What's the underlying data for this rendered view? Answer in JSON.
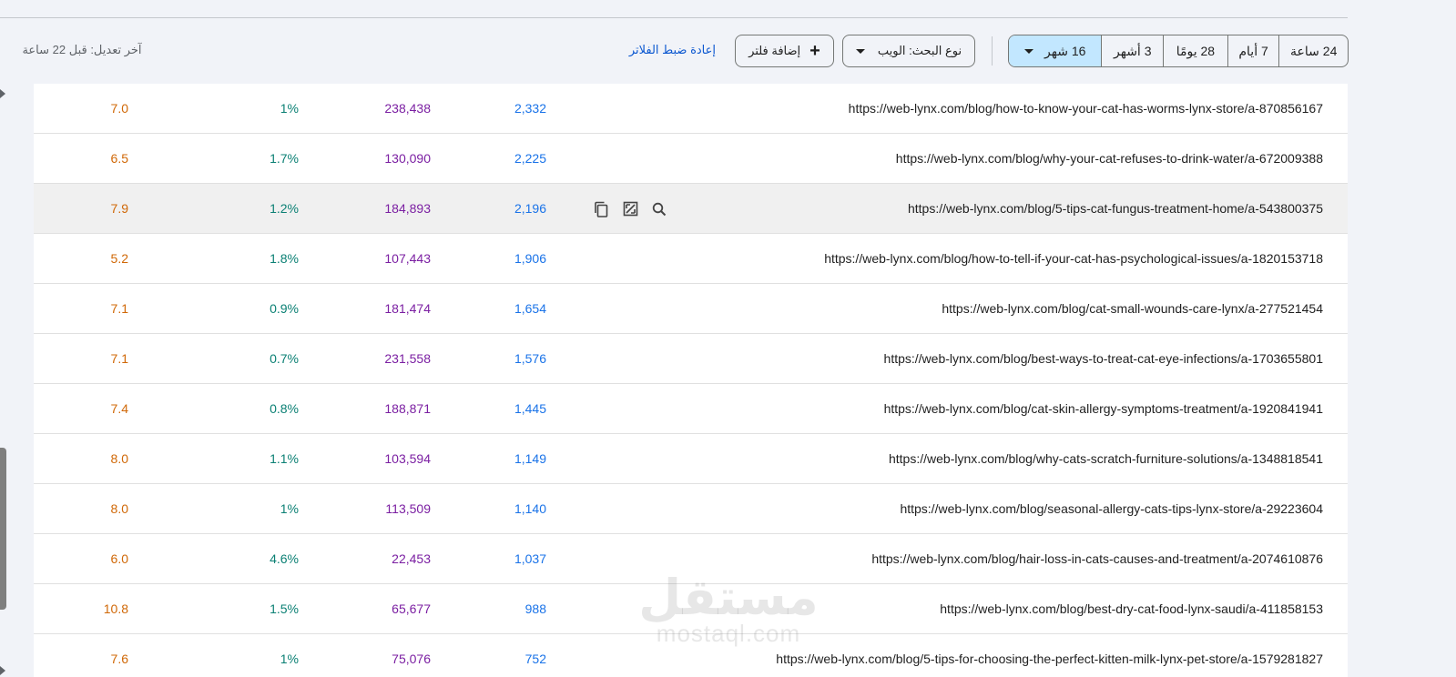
{
  "toolbar": {
    "date_ranges": [
      {
        "label": "24 ساعة",
        "active": false
      },
      {
        "label": "7 أيام",
        "active": false
      },
      {
        "label": "28 يومًا",
        "active": false
      },
      {
        "label": "3 أشهر",
        "active": false
      },
      {
        "label": "16 شهر",
        "active": true
      }
    ],
    "search_type_label": "نوع البحث: الويب",
    "add_filter_label": "إضافة فلتر",
    "reset_filters_label": "إعادة ضبط الفلاتر",
    "last_updated": "آخر تعديل: قبل 22 ساعة"
  },
  "colors": {
    "clicks": "#1a73e8",
    "impressions": "#7b1fa2",
    "ctr": "#0b8074",
    "position": "#d06807",
    "active_segment": "#c2e7ff"
  },
  "row_actions": [
    "copy-icon",
    "open-in-new-icon",
    "search-icon"
  ],
  "rows": [
    {
      "url": "https://web-lynx.com/blog/how-to-know-your-cat-has-worms-lynx-store/a-870856167",
      "clicks": "2,332",
      "impressions": "238,438",
      "ctr": "1%",
      "position": "7.0"
    },
    {
      "url": "https://web-lynx.com/blog/why-your-cat-refuses-to-drink-water/a-672009388",
      "clicks": "2,225",
      "impressions": "130,090",
      "ctr": "1.7%",
      "position": "6.5"
    },
    {
      "url": "https://web-lynx.com/blog/5-tips-cat-fungus-treatment-home/a-543800375",
      "clicks": "2,196",
      "impressions": "184,893",
      "ctr": "1.2%",
      "position": "7.9",
      "hover": true
    },
    {
      "url": "https://web-lynx.com/blog/how-to-tell-if-your-cat-has-psychological-issues/a-1820153718",
      "clicks": "1,906",
      "impressions": "107,443",
      "ctr": "1.8%",
      "position": "5.2"
    },
    {
      "url": "https://web-lynx.com/blog/cat-small-wounds-care-lynx/a-277521454",
      "clicks": "1,654",
      "impressions": "181,474",
      "ctr": "0.9%",
      "position": "7.1"
    },
    {
      "url": "https://web-lynx.com/blog/best-ways-to-treat-cat-eye-infections/a-1703655801",
      "clicks": "1,576",
      "impressions": "231,558",
      "ctr": "0.7%",
      "position": "7.1"
    },
    {
      "url": "https://web-lynx.com/blog/cat-skin-allergy-symptoms-treatment/a-1920841941",
      "clicks": "1,445",
      "impressions": "188,871",
      "ctr": "0.8%",
      "position": "7.4"
    },
    {
      "url": "https://web-lynx.com/blog/why-cats-scratch-furniture-solutions/a-1348818541",
      "clicks": "1,149",
      "impressions": "103,594",
      "ctr": "1.1%",
      "position": "8.0"
    },
    {
      "url": "https://web-lynx.com/blog/seasonal-allergy-cats-tips-lynx-store/a-29223604",
      "clicks": "1,140",
      "impressions": "113,509",
      "ctr": "1%",
      "position": "8.0"
    },
    {
      "url": "https://web-lynx.com/blog/hair-loss-in-cats-causes-and-treatment/a-2074610876",
      "clicks": "1,037",
      "impressions": "22,453",
      "ctr": "4.6%",
      "position": "6.0"
    },
    {
      "url": "https://web-lynx.com/blog/best-dry-cat-food-lynx-saudi/a-411858153",
      "clicks": "988",
      "impressions": "65,677",
      "ctr": "1.5%",
      "position": "10.8"
    },
    {
      "url": "https://web-lynx.com/blog/5-tips-for-choosing-the-perfect-kitten-milk-lynx-pet-store/a-1579281827",
      "clicks": "752",
      "impressions": "75,076",
      "ctr": "1%",
      "position": "7.6"
    }
  ],
  "watermark": {
    "arabic": "مستقل",
    "latin": "mostaql.com"
  }
}
